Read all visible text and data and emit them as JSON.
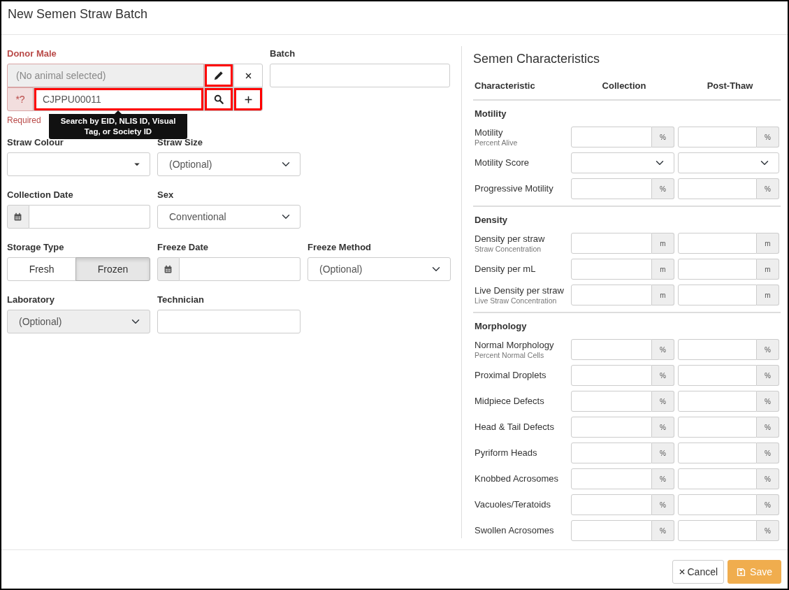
{
  "dialog": {
    "title": "New Semen Straw Batch"
  },
  "donor": {
    "label": "Donor Male",
    "selected_value": "(No animal selected)",
    "edit_highlighted": true,
    "search_prefix": "*?",
    "search_value": "CJPPU00011",
    "search_highlighted": true,
    "search_button_highlighted": true,
    "add_highlighted": true,
    "error": "Required",
    "tooltip": "Search by EID, NLIS ID, Visual Tag, or Society ID"
  },
  "batch": {
    "label": "Batch"
  },
  "field_rows": [
    [
      {
        "kind": "dropdown",
        "label": "Straw Colour"
      },
      {
        "kind": "select",
        "label": "Straw Size",
        "value": "(Optional)"
      }
    ],
    [
      {
        "kind": "date",
        "label": "Collection Date"
      },
      {
        "kind": "select",
        "label": "Sex",
        "value": "Conventional"
      }
    ],
    [
      {
        "kind": "toggle",
        "label": "Storage Type",
        "options": [
          {
            "label": "Fresh",
            "selected": false
          },
          {
            "label": "Frozen",
            "selected": true
          }
        ]
      },
      {
        "kind": "date",
        "label": "Freeze Date"
      },
      {
        "kind": "select",
        "label": "Freeze Method",
        "value": "(Optional)"
      }
    ],
    [
      {
        "kind": "select",
        "label": "Laboratory",
        "value": "(Optional)",
        "disabled": true
      },
      {
        "kind": "text",
        "label": "Technician"
      }
    ]
  ],
  "characteristics": {
    "title": "Semen Characteristics",
    "columns": [
      "Characteristic",
      "Collection",
      "Post-Thaw"
    ],
    "sections": [
      {
        "title": "Motility",
        "rows": [
          {
            "label": "Motility",
            "sublabel": "Percent Alive",
            "cells": [
              {
                "kind": "unit",
                "unit": "%"
              },
              {
                "kind": "unit",
                "unit": "%"
              }
            ]
          },
          {
            "label": "Motility Score",
            "cells": [
              {
                "kind": "select"
              },
              {
                "kind": "select"
              }
            ]
          },
          {
            "label": "Progressive Motility",
            "cells": [
              {
                "kind": "unit",
                "unit": "%"
              },
              {
                "kind": "unit",
                "unit": "%"
              }
            ]
          }
        ]
      },
      {
        "title": "Density",
        "rows": [
          {
            "label": "Density per straw",
            "sublabel": "Straw Concentration",
            "cells": [
              {
                "kind": "unit",
                "unit": "m"
              },
              {
                "kind": "unit",
                "unit": "m"
              }
            ]
          },
          {
            "label": "Density per mL",
            "cells": [
              {
                "kind": "unit",
                "unit": "m"
              },
              {
                "kind": "unit",
                "unit": "m"
              }
            ]
          },
          {
            "label": "Live Density per straw",
            "sublabel": "Live Straw Concentration",
            "cells": [
              {
                "kind": "unit",
                "unit": "m"
              },
              {
                "kind": "unit",
                "unit": "m"
              }
            ]
          }
        ]
      },
      {
        "title": "Morphology",
        "rows": [
          {
            "label": "Normal Morphology",
            "sublabel": "Percent Normal Cells",
            "cells": [
              {
                "kind": "unit",
                "unit": "%"
              },
              {
                "kind": "unit",
                "unit": "%"
              }
            ]
          },
          {
            "label": "Proximal Droplets",
            "cells": [
              {
                "kind": "unit",
                "unit": "%"
              },
              {
                "kind": "unit",
                "unit": "%"
              }
            ]
          },
          {
            "label": "Midpiece Defects",
            "cells": [
              {
                "kind": "unit",
                "unit": "%"
              },
              {
                "kind": "unit",
                "unit": "%"
              }
            ]
          },
          {
            "label": "Head & Tail Defects",
            "cells": [
              {
                "kind": "unit",
                "unit": "%"
              },
              {
                "kind": "unit",
                "unit": "%"
              }
            ]
          },
          {
            "label": "Pyriform Heads",
            "cells": [
              {
                "kind": "unit",
                "unit": "%"
              },
              {
                "kind": "unit",
                "unit": "%"
              }
            ]
          },
          {
            "label": "Knobbed Acrosomes",
            "cells": [
              {
                "kind": "unit",
                "unit": "%"
              },
              {
                "kind": "unit",
                "unit": "%"
              }
            ]
          },
          {
            "label": "Vacuoles/Teratoids",
            "cells": [
              {
                "kind": "unit",
                "unit": "%"
              },
              {
                "kind": "unit",
                "unit": "%"
              }
            ]
          },
          {
            "label": "Swollen Acrosomes",
            "cells": [
              {
                "kind": "unit",
                "unit": "%"
              },
              {
                "kind": "unit",
                "unit": "%"
              }
            ]
          }
        ]
      }
    ]
  },
  "buttons": [
    {
      "kind": "cancel",
      "label": "Cancel"
    },
    {
      "kind": "save",
      "label": "Save"
    }
  ]
}
